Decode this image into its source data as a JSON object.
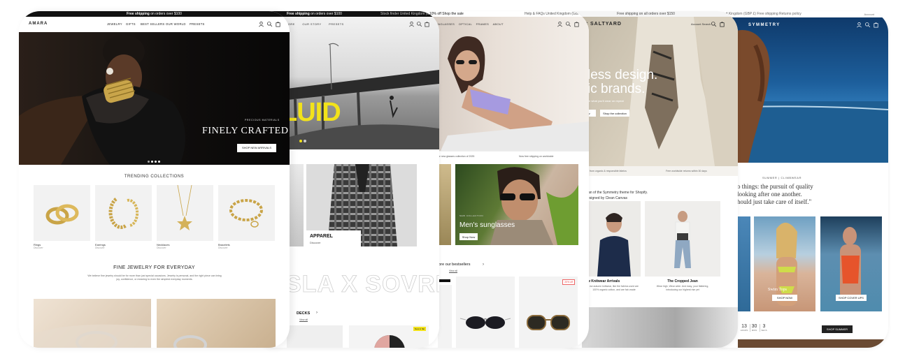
{
  "amara": {
    "announcement_bold": "Free shipping",
    "announcement_rest": " on orders over $100",
    "brand": "AMARA",
    "nav": [
      "JEWELRY",
      "GIFTS",
      "BEST SELLERS",
      "OUR WORLD",
      "PRESETS"
    ],
    "hero_kicker": "PRECIOUS MATERIALS",
    "hero_title": "FINELY CRAFTED",
    "hero_cta": "SHOP NEW ARRIVALS",
    "trending": "TRENDING COLLECTIONS",
    "collections": [
      {
        "name": "Rings",
        "sub": "Discover"
      },
      {
        "name": "Earrings",
        "sub": "Discover"
      },
      {
        "name": "Necklaces",
        "sub": "Discover"
      },
      {
        "name": "Bracelets",
        "sub": "Discover"
      }
    ],
    "feature_title": "FINE JEWELRY FOR EVERYDAY",
    "feature_text": "We believe fine jewelry should be for more than just special occasions. Jewelry is personal, and the right piece can bring joy, confidence, or meaning to even the simplest everyday moments."
  },
  "skate": {
    "announcement_bold": "Free shipping",
    "announcement_rest": " on orders over $100",
    "topright": "Stock finder   United Kingdom (GBP £)   English",
    "nav": [
      "STORE",
      "OUR STORY",
      "PRESETS"
    ],
    "hero_word": "LUID",
    "apparel_title": "APPAREL",
    "apparel_sub": "Discover",
    "marquee": "SLA X SOVRE",
    "decks_title": "DECKS",
    "decks_sub": "View all",
    "badge": "New in flat"
  },
  "eyewear": {
    "announcement": "10% off  Shop the sale",
    "topright": "Help & FAQs   United Kingdom (GBP £)   English",
    "nav": [
      "SUNGLASSES",
      "OPTICAL",
      "FRAMES",
      "ABOUT"
    ],
    "strip_left": "Our new glasses collection of 2025",
    "strip_right": "Now free shipping on worldwide",
    "card_kicker": "NEW COLLECTION",
    "card_title": "Men's sunglasses",
    "card_cta": "Shop Now",
    "best_title": "lore our bestsellers",
    "best_sub": "View all",
    "badge_left": "",
    "badge_right": "20% off"
  },
  "saltyard": {
    "announcement": "Free shipping on all orders over $150",
    "brand": "SALTYARD",
    "topnav": "Account   Search",
    "hero_line1": "less design.",
    "hero_line2": "ic brands.",
    "hero_sub": "ve what you'll wear on repeat",
    "cta1": "ew",
    "cta2": "Shop the collection",
    "strip_left": "d from organic & responsible fabrics",
    "strip_right": "Free worldwide returns within 30 days",
    "intro1": "ian of the Symmetry theme for Shopify.",
    "intro2": "esigned by Clean Canvas",
    "prod1_name": "w Knitwear Arrivals",
    "prod1_desc": "ew autumn knitwear, like the fabrics used are 100% organic cotton, and are fair-made",
    "prod2_name": "The Cropped Jean",
    "prod2_desc": "Wear high, Wear wide. And easy, your flattering, introducing our highest rise yet"
  },
  "symmetry": {
    "topbar": "United Kingdom (GBP £)   Free shipping   Returns policy",
    "topright": "Account",
    "brand": "SYMMETRY",
    "kicker": "SUMMER | CLIMBWEAR",
    "quote1": "o things: the pursuit of quality",
    "quote2": "looking after one another.",
    "quote3": "hould just take care of itself.\"",
    "swim_label": "Swim Tops",
    "cta1": "SHOP NOW",
    "cta2": "SHOP COVER UPS",
    "countdown": [
      {
        "n": "13",
        "l": "HOURS"
      },
      {
        "n": "30",
        "l": "MINS"
      },
      {
        "n": "3",
        "l": "SECS"
      }
    ],
    "cta3": "SHOP SUMMER"
  }
}
